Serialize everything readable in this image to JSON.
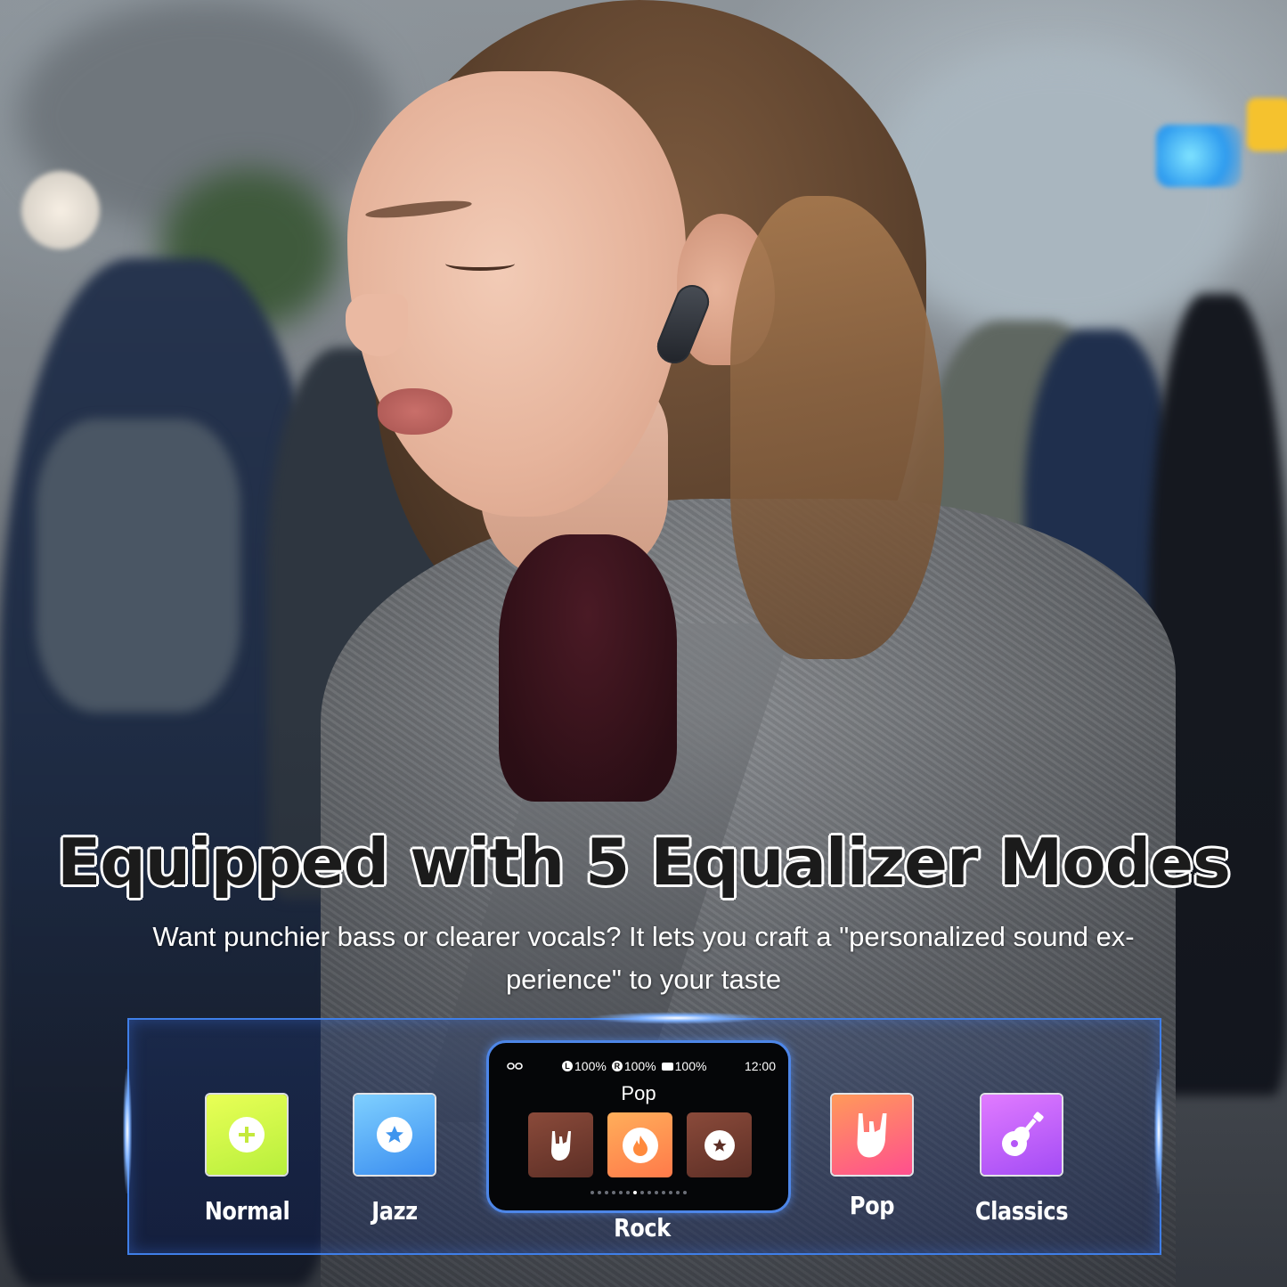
{
  "headline": "Equipped with 5 Equalizer Modes",
  "subtitle_line1": "Want punchier bass or clearer vocals? It lets you craft a \"personalized sound ex-",
  "subtitle_line2": "perience\" to your taste",
  "modes": {
    "normal": {
      "label": "Normal",
      "icon": "plus-icon",
      "color": "#d6f94a"
    },
    "jazz": {
      "label": "Jazz",
      "icon": "star-icon",
      "color": "#4fa8f5"
    },
    "rock": {
      "label": "Rock",
      "icon": "flame-icon",
      "color": "#ff8c4f"
    },
    "pop": {
      "label": "Pop",
      "icon": "rock-hand-icon",
      "color": "#ff6d76"
    },
    "classics": {
      "label": "Classics",
      "icon": "guitar-icon",
      "color": "#c35ff9"
    }
  },
  "device": {
    "link_icon": "link-icon",
    "left_battery": "100%",
    "left_marker": "L",
    "right_battery": "100%",
    "right_marker": "R",
    "case_battery": "100%",
    "time": "12:00",
    "current_title": "Pop",
    "page_dots_total": 14,
    "active_dot_index": 6
  },
  "accent_color": "#3f7fe8"
}
